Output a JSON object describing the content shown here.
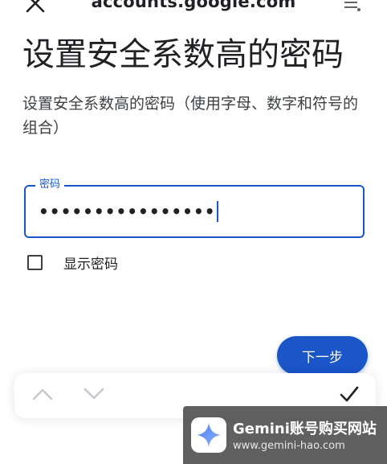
{
  "browser": {
    "url": "accounts.google.com",
    "close_icon": "close-icon",
    "menu_icon": "tab-menu-icon"
  },
  "page": {
    "title": "设置安全系数高的密码",
    "subtitle": "设置安全系数高的密码（使用字母、数字和符号的组合）"
  },
  "password_field": {
    "label": "密码",
    "value": "••••••••••••••••"
  },
  "show_password": {
    "label": "显示密码",
    "checked": false
  },
  "actions": {
    "next_label": "下一步"
  },
  "accessory_bar": {
    "prev_icon": "chevron-up-icon",
    "next_icon": "chevron-down-icon",
    "done_icon": "checkmark-icon"
  },
  "watermark": {
    "title": "Gemini账号购买网站",
    "url": "www.gemini-hao.com"
  },
  "colors": {
    "accent": "#1a56c8",
    "text": "#202124"
  }
}
